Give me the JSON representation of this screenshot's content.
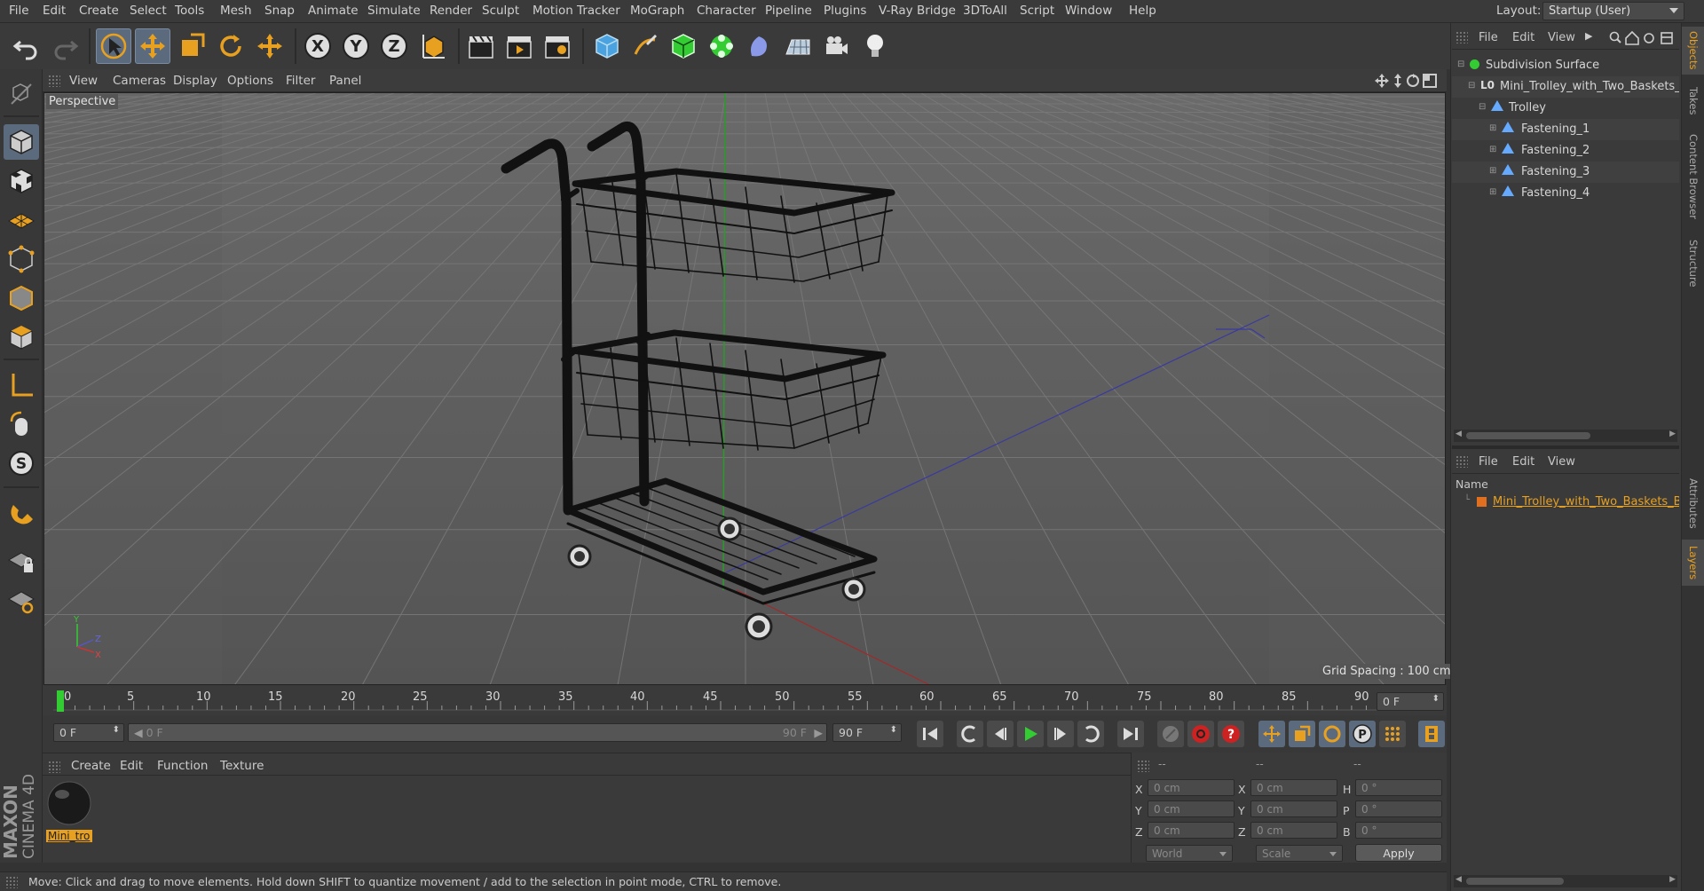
{
  "menu": [
    "File",
    "Edit",
    "Create",
    "Select",
    "Tools",
    "Mesh",
    "Snap",
    "Animate",
    "Simulate",
    "Render",
    "Sculpt",
    "Motion Tracker",
    "MoGraph",
    "Character",
    "Pipeline",
    "Plugins",
    "V-Ray Bridge",
    "3DToAll",
    "Script",
    "Window",
    "Help"
  ],
  "layout": {
    "label": "Layout:",
    "value": "Startup (User)"
  },
  "viewport": {
    "menu": [
      "View",
      "Cameras",
      "Display",
      "Options",
      "Filter",
      "Panel"
    ],
    "label": "Perspective",
    "grid_spacing": "Grid Spacing : 100 cm",
    "axis_labels": {
      "y": "Y",
      "z": "Z",
      "x": "X"
    }
  },
  "timeline": {
    "ticks": [
      "0",
      "5",
      "10",
      "15",
      "20",
      "25",
      "30",
      "35",
      "40",
      "45",
      "50",
      "55",
      "60",
      "65",
      "70",
      "75",
      "80",
      "85",
      "90"
    ],
    "end_field": "0 F",
    "current_frame": "0 F",
    "range_start": "0 F",
    "range_end_inner": "90 F",
    "range_end": "90 F"
  },
  "materials": {
    "menu": [
      "Create",
      "Edit",
      "Function",
      "Texture"
    ],
    "item_label": "Mini_tro"
  },
  "coords": {
    "headers": [
      "--",
      "--",
      "--"
    ],
    "rows": [
      {
        "a": "X",
        "a_val": "0 cm",
        "b": "X",
        "b_val": "0 cm",
        "c": "H",
        "c_val": "0 °"
      },
      {
        "a": "Y",
        "a_val": "0 cm",
        "b": "Y",
        "b_val": "0 cm",
        "c": "P",
        "c_val": "0 °"
      },
      {
        "a": "Z",
        "a_val": "0 cm",
        "b": "Z",
        "b_val": "0 cm",
        "c": "B",
        "c_val": "0 °"
      }
    ],
    "mode1": "World",
    "mode2": "Scale",
    "apply": "Apply"
  },
  "status": "Move: Click and drag to move elements. Hold down SHIFT to quantize movement / add to the selection in point mode, CTRL to remove.",
  "objects": {
    "menu": [
      "File",
      "Edit",
      "View"
    ],
    "tree": [
      {
        "name": "Subdivision Surface"
      },
      {
        "name": "Mini_Trolley_with_Two_Baskets_B"
      },
      {
        "name": "Trolley"
      },
      {
        "name": "Fastening_1"
      },
      {
        "name": "Fastening_2"
      },
      {
        "name": "Fastening_3"
      },
      {
        "name": "Fastening_4"
      }
    ]
  },
  "layers": {
    "menu": [
      "File",
      "Edit",
      "View"
    ],
    "column": "Name",
    "item": "Mini_Trolley_with_Two_Baskets_Bl"
  },
  "side_tabs": [
    "Objects",
    "Takes",
    "Content Browser",
    "Structure",
    "Attributes",
    "Layers"
  ],
  "brand": {
    "maxon": "MAXON",
    "product": "CINEMA 4D"
  },
  "colors": {
    "accent": "#e8a020",
    "selected_tool": "#5b6b7d",
    "green_marker": "#3c3"
  }
}
